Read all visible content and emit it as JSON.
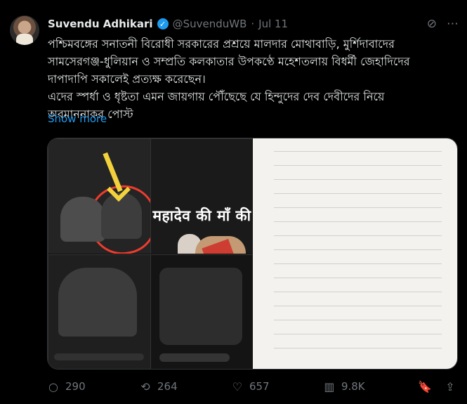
{
  "post": {
    "author_name": "Suvendu Adhikari",
    "handle": "@SuvenduWB",
    "separator": "·",
    "date": "Jul 11",
    "text_lines": [
      "পশ্চিমবঙ্গের সনাতনী বিরোধী সরকারের প্রশ্রয়ে মালদার মোথাবাড়ি, মুর্শিদাবাদের",
      "সামসেরগঞ্জ-ধুলিয়ান ও সম্প্রতি কলকাতার উপকণ্ঠে মহেশতলায় বিধর্মী জেহাদিদের",
      "দাপাদাপি সকালেই প্রত্যক্ষ করেছেন।",
      "এদের স্পর্ধা ও ধৃষ্টতা এমন জায়গায় পৌঁছেছে যে হিন্দুদের দেব দেবীদের নিয়ে",
      "অবমাননাকর পোস্ট"
    ],
    "show_more": "Show more",
    "media": {
      "hindi_caption": "महादेव की माँ की"
    },
    "actions": {
      "replies": "290",
      "reposts": "264",
      "likes": "657",
      "views": "9.8K"
    }
  }
}
